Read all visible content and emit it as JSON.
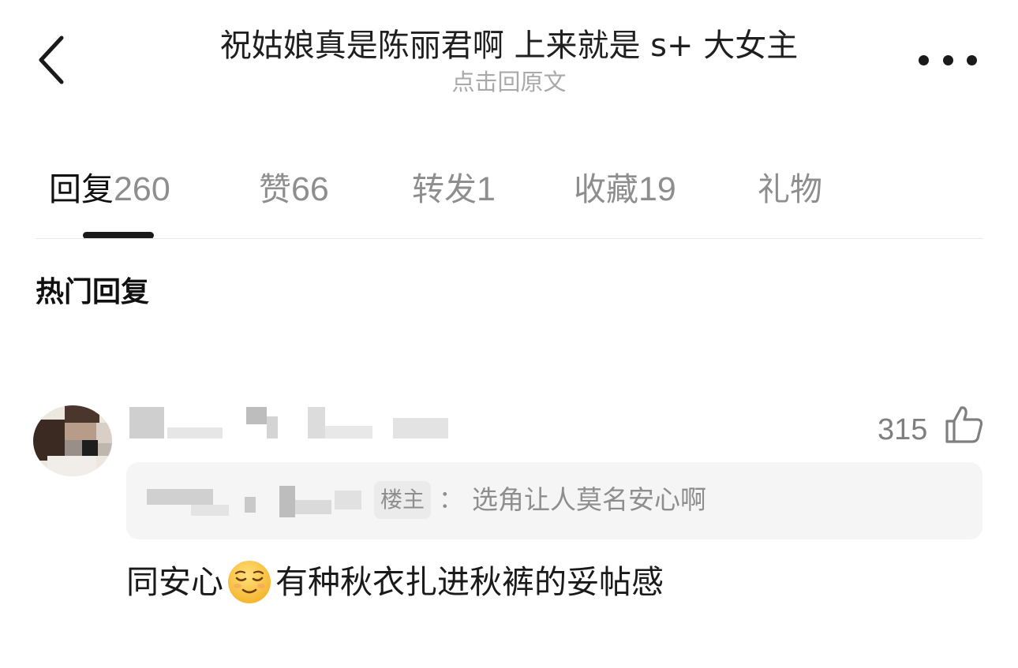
{
  "header": {
    "title": "祝姑娘真是陈丽君啊 上来就是 s+ 大女主",
    "subtitle": "点击回原文",
    "back_icon": "chevron-left-icon",
    "more_icon": "more-horizontal-icon"
  },
  "tabs": [
    {
      "label": "回复",
      "count": "260",
      "active": true
    },
    {
      "label": "赞",
      "count": "66",
      "active": false
    },
    {
      "label": "转发",
      "count": "1",
      "active": false
    },
    {
      "label": "收藏",
      "count": "19",
      "active": false
    },
    {
      "label": "礼物",
      "count": "",
      "active": false
    }
  ],
  "section": {
    "title": "热门回复"
  },
  "comment": {
    "like_count": "315",
    "like_icon": "thumbs-up-icon",
    "quote": {
      "op_badge": "楼主",
      "colon": "：",
      "text": "选角让人莫名安心啊"
    },
    "body": {
      "before_emoji": "同安心",
      "emoji": "relieved-face-emoji",
      "after_emoji": "有种秋衣扎进秋裤的妥帖感"
    }
  },
  "colors": {
    "primary_text": "#1a1a1a",
    "secondary_text": "#8e8e8e",
    "quote_background": "#f5f5f5",
    "divider": "#e6e6e6"
  }
}
